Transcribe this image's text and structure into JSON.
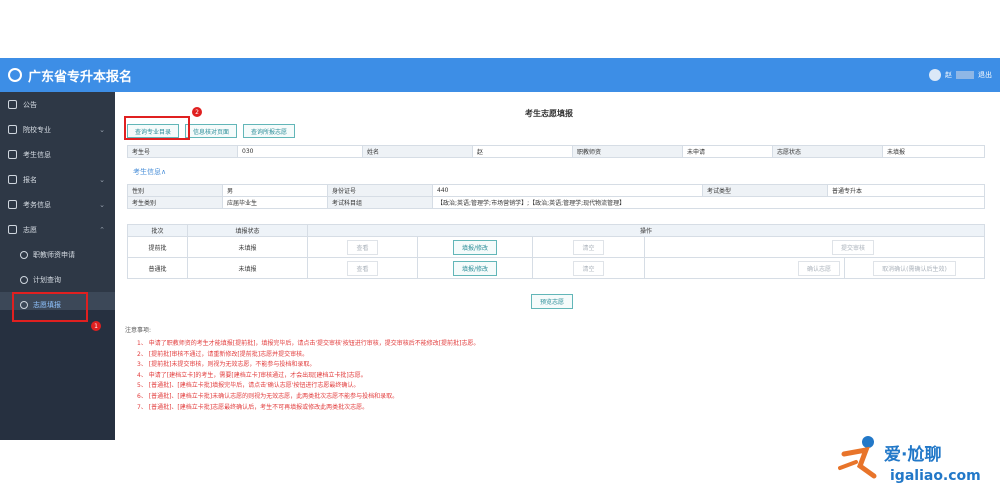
{
  "app": {
    "title": "广东省专升本报名"
  },
  "user": {
    "name_prefix": "赵",
    "logout": "退出"
  },
  "sidebar": {
    "items": [
      {
        "label": "公告",
        "chevron": ""
      },
      {
        "label": "院校专业",
        "chevron": "⌄"
      },
      {
        "label": "考生信息",
        "chevron": ""
      },
      {
        "label": "报名",
        "chevron": "⌄"
      },
      {
        "label": "考务信息",
        "chevron": "⌄"
      },
      {
        "label": "志愿",
        "chevron": "⌃"
      }
    ],
    "sub_items": [
      {
        "label": "职教师资申请"
      },
      {
        "label": "计划查询"
      },
      {
        "label": "志愿填报"
      }
    ],
    "badge": "1"
  },
  "page": {
    "title": "考生志愿填报",
    "buttons": [
      "查询专业目录",
      "信息核对页面",
      "查询所报志愿"
    ],
    "badge": "2"
  },
  "candidate": {
    "row1": [
      {
        "label": "考生号",
        "value": "030"
      },
      {
        "label": "姓名",
        "value": "赵"
      },
      {
        "label": "职教师资",
        "value": "未申请"
      },
      {
        "label": "志愿状态",
        "value": "未填报"
      }
    ],
    "section_link": "考生信息∧",
    "row2": [
      {
        "label": "性别",
        "value": "男"
      },
      {
        "label": "身份证号",
        "value": "440"
      },
      {
        "label": "考试类型",
        "value": "普通专升本"
      }
    ],
    "row3": [
      {
        "label": "考生类别",
        "value": "应届毕业生"
      },
      {
        "label": "考试科目组",
        "value": "【政治;英语;管理学;市场营销学】;【政治;英语;管理学;现代物流管理】"
      }
    ]
  },
  "grid": {
    "headers": [
      "批次",
      "填报状态",
      "操作"
    ],
    "rows": [
      {
        "batch": "提前批",
        "status": "未填报",
        "actions": [
          "查看",
          "填报/修改",
          "清空",
          "提交审核"
        ]
      },
      {
        "batch": "普通批",
        "status": "未填报",
        "actions": [
          "查看",
          "填报/修改",
          "清空",
          "确认志愿",
          "取消确认(需确认后生效)"
        ]
      }
    ]
  },
  "preview_button": "预览志愿",
  "notes": {
    "title": "注意事项:",
    "items": [
      "1、 申请了职教师资的考生才能填报[提前批]，填报完毕后，请点击'提交审核'按钮进行审核，提交审核后不能修改[提前批]志愿。",
      "2、 [提前批]审核不通过，请重新修改[提前批]志愿并提交审核。",
      "3、 [提前批]未提交审核，则视为无效志愿，不能参与投档和录取。",
      "4、 申请了[建档立卡]的考生，需要[建档立卡]审核通过，才会出现[建档立卡批]志愿。",
      "5、 [普通批]、[建档立卡批]填报完毕后，请点击'确认志愿'按钮进行志愿最终确认。",
      "6、 [普通批]、[建档立卡批]未确认志愿的则视为无效志愿，此两类批次志愿不能参与投档和录取。",
      "7、 [普通批]、[建档立卡批]志愿最终确认后，考生不可再填报或修改此两类批次志愿。"
    ]
  },
  "watermark": {
    "cn": "爱·尬聊",
    "url": "igaliao.com"
  },
  "colors": {
    "topbar": "#3d8ee6",
    "sidebar": "#2e3846",
    "highlight": "#e02020",
    "note_text": "#e23c3c"
  }
}
